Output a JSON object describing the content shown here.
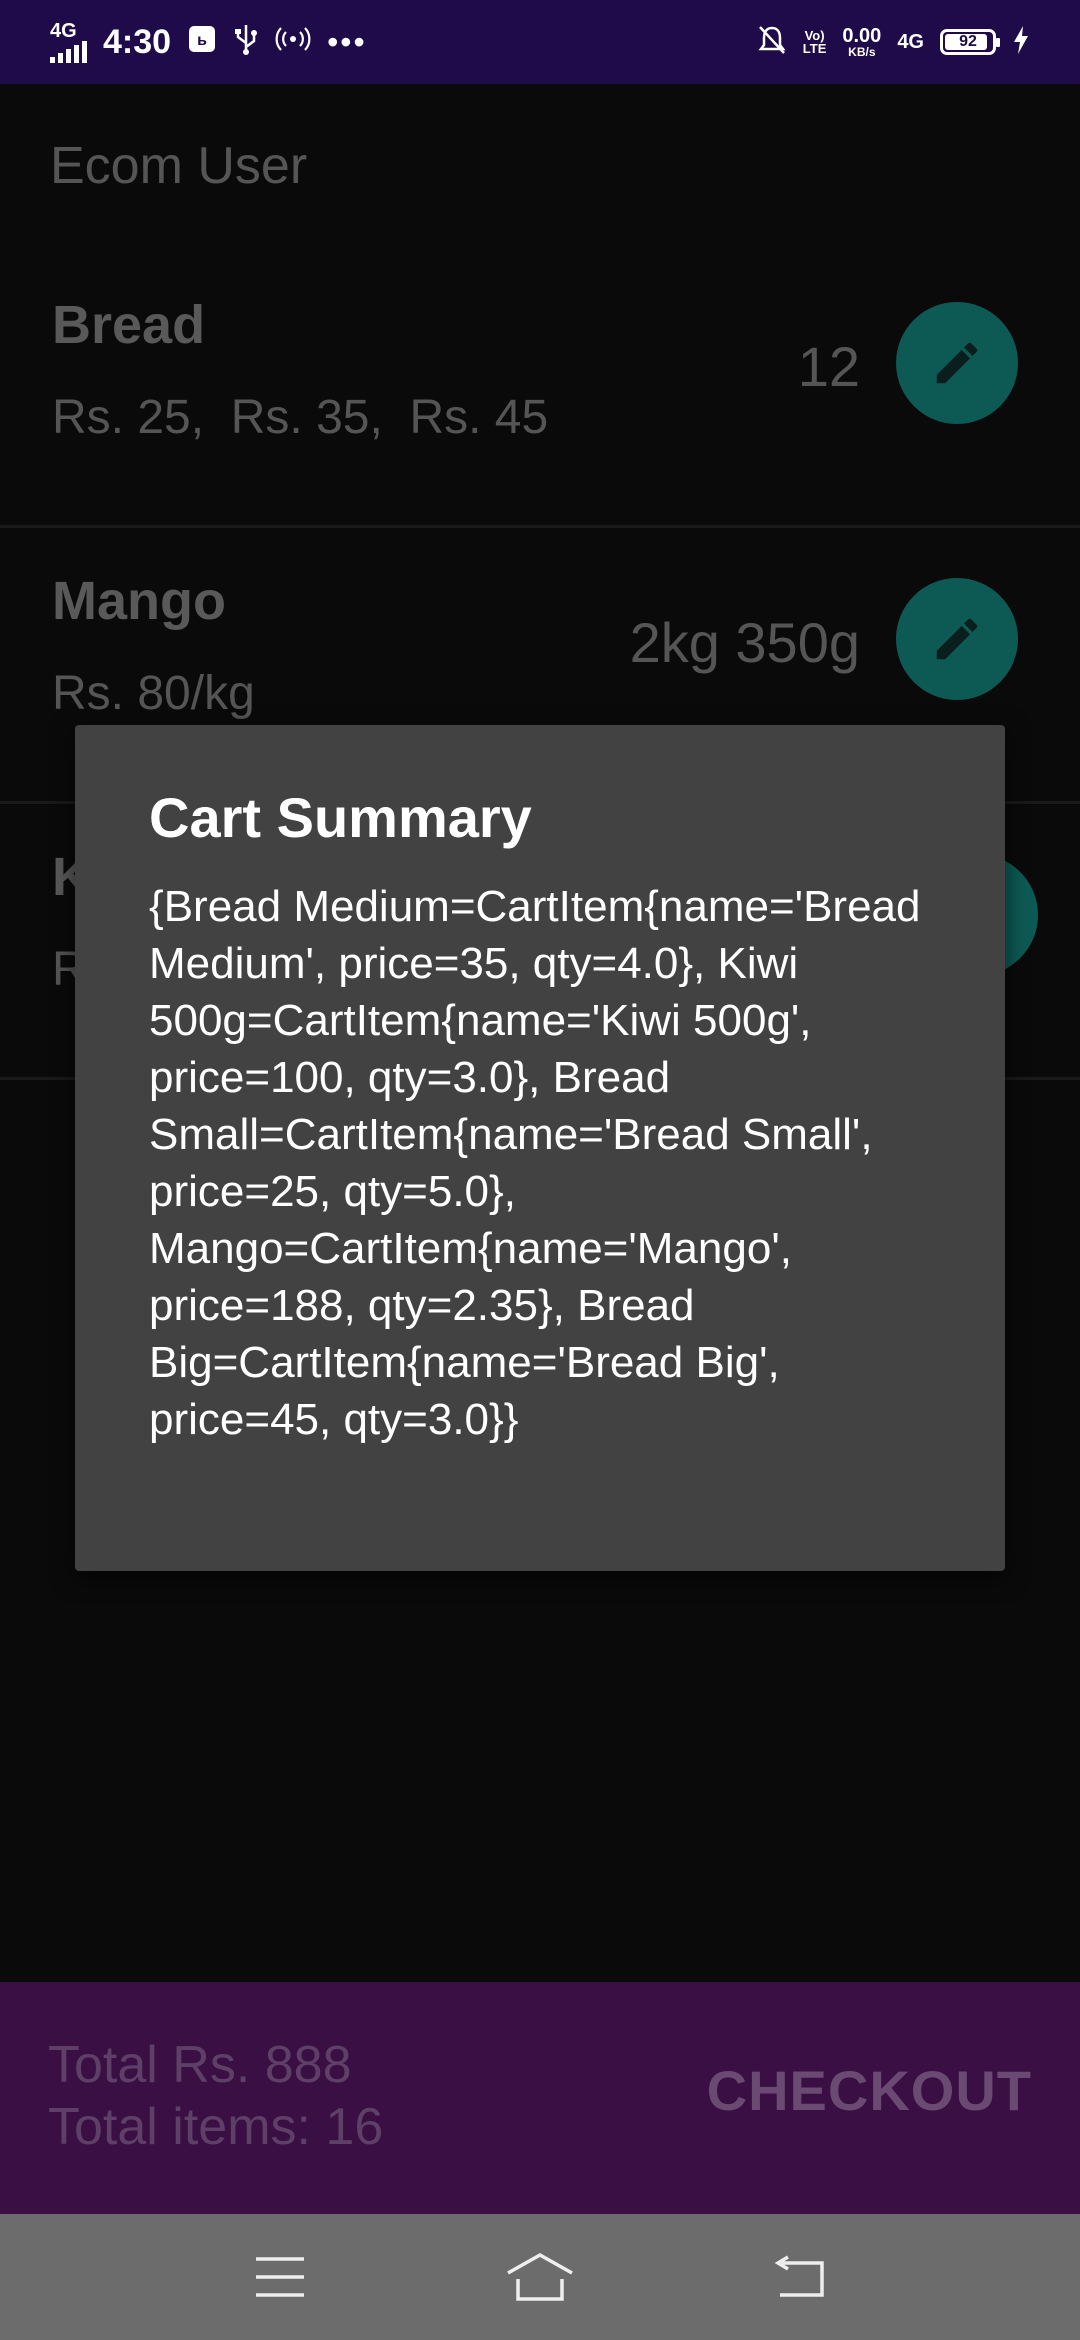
{
  "status_bar": {
    "network": "4G",
    "time": "4:30",
    "volte_top": "Vo)",
    "volte_bottom": "LTE",
    "speed_value": "0.00",
    "speed_unit": "KB/s",
    "network2": "4G",
    "battery": "92",
    "battery_level": 0.92,
    "dots": "•••"
  },
  "app": {
    "title": "Ecom User",
    "products": [
      {
        "name": "Bread",
        "prices": "Rs. 25,  Rs. 35,  Rs. 45",
        "qty": "12"
      },
      {
        "name": "Mango",
        "prices": "Rs. 80/kg",
        "qty": "2kg 350g"
      },
      {
        "name": "K",
        "prices": "R",
        "qty": ""
      }
    ]
  },
  "bottom_bar": {
    "total_price": "Total Rs. 888",
    "total_items": "Total items: 16",
    "checkout_label": "CHECKOUT"
  },
  "dialog": {
    "title": "Cart Summary",
    "message": "{Bread Medium=CartItem{name='Bread Medium', price=35, qty=4.0}, Kiwi 500g=CartItem{name='Kiwi 500g', price=100, qty=3.0}, Bread Small=CartItem{name='Bread Small', price=25, qty=5.0}, Mango=CartItem{name='Mango', price=188, qty=2.35}, Bread Big=CartItem{name='Bread Big', price=45, qty=3.0}}"
  },
  "nav": {
    "icons": [
      "menu-icon",
      "home-icon",
      "back-icon"
    ]
  },
  "colors": {
    "status_bar": "#1f0a4a",
    "edit_button": "#0d5a55",
    "bottom_bar": "#3a0f44",
    "dialog": "#424242"
  }
}
